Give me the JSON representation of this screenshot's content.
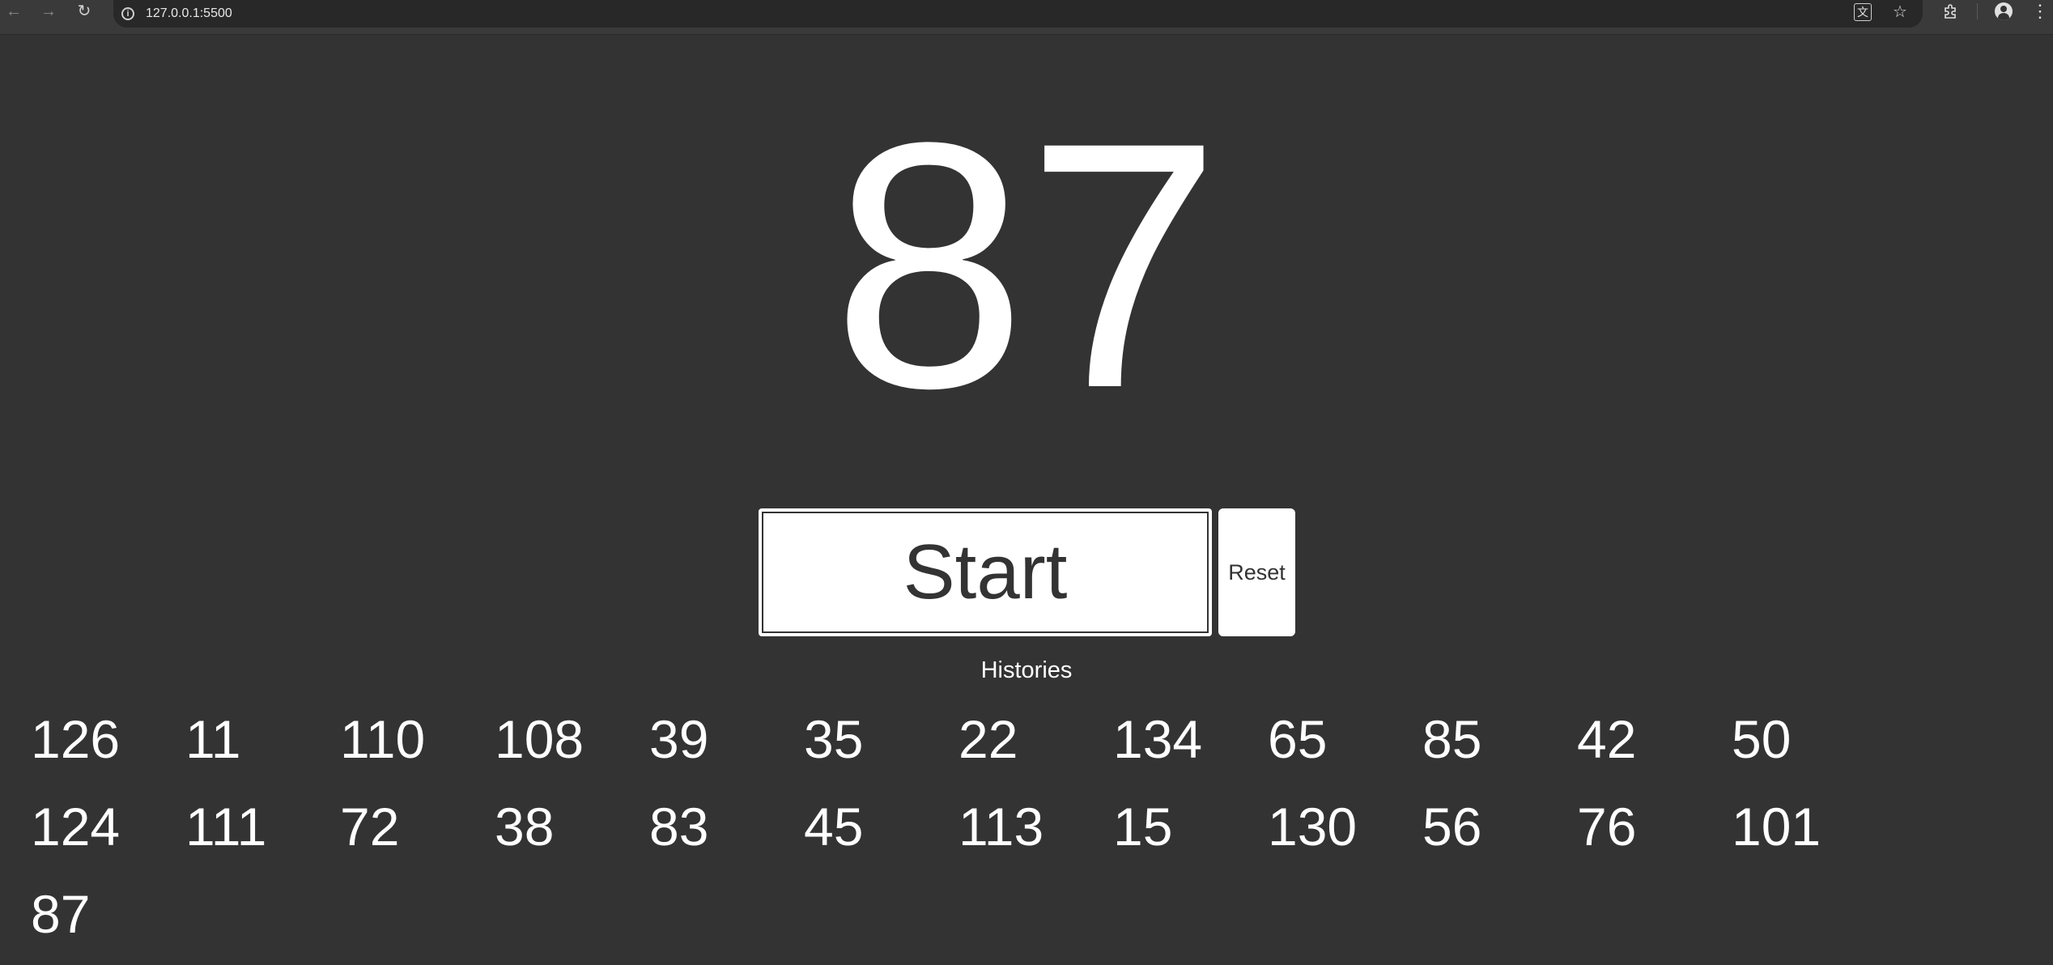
{
  "browser": {
    "url": "127.0.0.1:5500",
    "icons": {
      "back": "back-arrow-icon",
      "forward": "forward-arrow-icon",
      "reload": "reload-icon",
      "info": "info-icon",
      "translate": "translate-icon",
      "bookmark": "star-icon",
      "extensions": "puzzle-icon",
      "profile": "profile-icon",
      "menu": "kebab-menu-icon"
    }
  },
  "main": {
    "current_number": "87",
    "start_label": "Start",
    "reset_label": "Reset",
    "histories_title": "Histories",
    "histories": [
      "126",
      "11",
      "110",
      "108",
      "39",
      "35",
      "22",
      "134",
      "65",
      "85",
      "42",
      "50",
      "124",
      "111",
      "72",
      "38",
      "83",
      "45",
      "113",
      "15",
      "130",
      "56",
      "76",
      "101",
      "87"
    ]
  },
  "colors": {
    "background": "#333333",
    "text": "#ffffff",
    "button_bg": "#ffffff",
    "button_text": "#333333",
    "chrome_bar": "#3a3a3a",
    "address_bar": "#282828"
  }
}
